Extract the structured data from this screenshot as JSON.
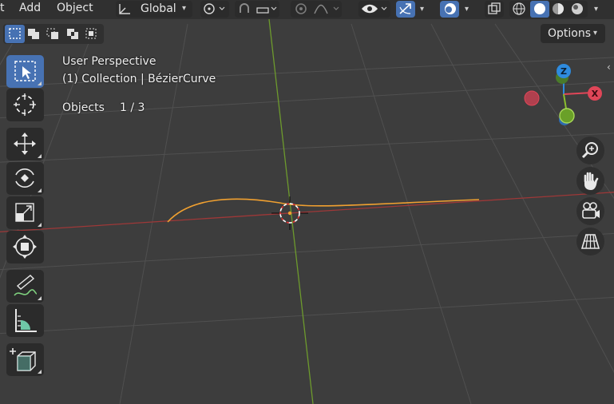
{
  "header": {
    "menu": [
      "t",
      "Add",
      "Object"
    ],
    "transform_orientation": "Global",
    "options_label": "Options"
  },
  "viewport": {
    "view_name": "User Perspective",
    "collection_line": "(1) Collection | BézierCurve",
    "objects_label": "Objects",
    "objects_count": "1 / 3"
  },
  "gizmo": {
    "z_label": "Z",
    "x_label": "X",
    "colors": {
      "x": "#e04658",
      "y": "#8bbf2e",
      "z": "#2e8bde"
    }
  },
  "toolbar": {
    "tools": [
      "select-box",
      "cursor",
      "move",
      "rotate",
      "scale",
      "transform",
      "annotate",
      "measure",
      "add-cube"
    ],
    "active_tool": "select-box"
  },
  "colors": {
    "accent": "#4772b3",
    "curve": "#f0a030",
    "x_axis": "#b03a3a",
    "y_axis": "#6a9a2a"
  }
}
